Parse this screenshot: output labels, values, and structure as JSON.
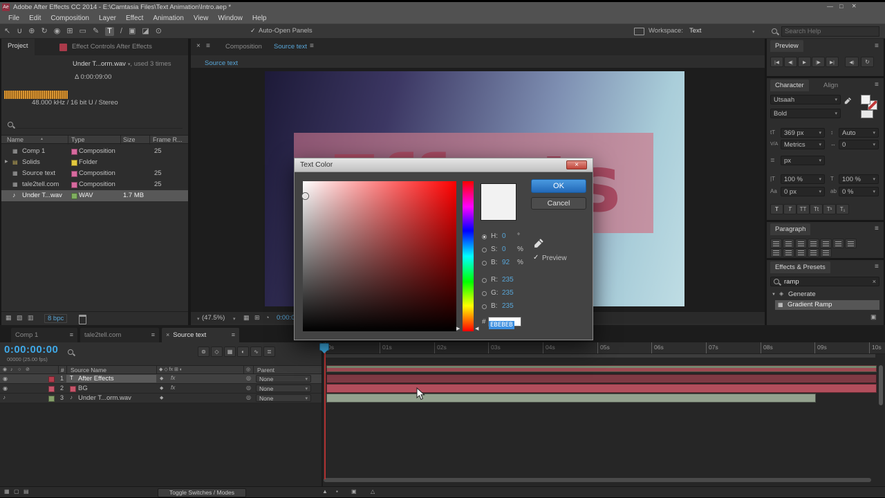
{
  "colors": {
    "accent_blue": "#58a6d8",
    "time_blue": "#3fa9e8",
    "bar_red_dark": "#7e3a44",
    "bar_red": "#b24e5c",
    "bar_green": "#93a18e",
    "box_pink_left": "#8d5673",
    "box_pink_right": "#c493a3",
    "headline_red": "#a84b63",
    "label_pink": "#d76a9e",
    "label_yellow": "#e3c93f",
    "label_green": "#7fae5f",
    "hex_selection": "#3d8fe0",
    "ok_blue": "#2a7fd0"
  },
  "icons": {
    "logo": "Ae",
    "minimize": "—",
    "maximize": "□",
    "close": "×",
    "burger": "≡",
    "dd": "▾",
    "check": "✓",
    "eye": "◉",
    "note": "♪",
    "diamond": "◆",
    "fx": "fx",
    "pick": "◎",
    "expand": "▶",
    "sort": "▲",
    "cat": "▼",
    "grid": "▦"
  },
  "titlebar": {
    "title": "Adobe After Effects CC 2014 - E:\\Camtasia Files\\Text Animation\\Intro.aep *"
  },
  "menus": [
    "File",
    "Edit",
    "Composition",
    "Layer",
    "Effect",
    "Animation",
    "View",
    "Window",
    "Help"
  ],
  "toolbar": {
    "tools": [
      "↖",
      "∪",
      "⊕",
      "↻",
      "◉",
      "⊞",
      "▭",
      "✎",
      "T",
      "/",
      "▣",
      "◪",
      "⊙"
    ],
    "auto_open": "Auto-Open Panels",
    "workspace_label": "Workspace:",
    "workspace_value": "Text",
    "search_placeholder": "Search Help"
  },
  "project": {
    "tab_project": "Project",
    "tab_effect_controls": "Effect Controls After Effects",
    "item_name": "Under T...orm.wav",
    "item_usage": ", used 3 times",
    "item_delta": "Δ 0:00:09:00",
    "item_audio": "48.000 kHz / 16 bit U / Stereo",
    "columns": [
      "Name",
      "Type",
      "Size",
      "Frame R..."
    ],
    "rows": [
      {
        "name": "Comp 1",
        "type": "Composition",
        "size": "",
        "frame": "25"
      },
      {
        "name": "Solids",
        "type": "Folder",
        "size": "",
        "frame": ""
      },
      {
        "name": "Source text",
        "type": "Composition",
        "size": "",
        "frame": "25"
      },
      {
        "name": "tale2tell.com",
        "type": "Composition",
        "size": "",
        "frame": "25"
      },
      {
        "name": "Under T...wav",
        "type": "WAV",
        "size": "1.7 MB",
        "frame": ""
      }
    ],
    "bit_depth": "8 bpc",
    "footer_icons": [
      "▦",
      "▧",
      "▥"
    ]
  },
  "comp": {
    "tab_composition": "Composition",
    "tab_source_text": "Source text",
    "breadcrumb": "Source text",
    "headline": "Effects",
    "zoom": "(47.5%)",
    "time": "0:00:00:00"
  },
  "dialog": {
    "title": "Text Color",
    "ok": "OK",
    "cancel": "Cancel",
    "rows": [
      {
        "label": "H:",
        "value": "0",
        "unit": "°"
      },
      {
        "label": "S:",
        "value": "0",
        "unit": "%"
      },
      {
        "label": "B:",
        "value": "92",
        "unit": "%"
      },
      {
        "label": "R:",
        "value": "235",
        "unit": ""
      },
      {
        "label": "G:",
        "value": "235",
        "unit": ""
      },
      {
        "label": "B:",
        "value": "235",
        "unit": ""
      }
    ],
    "hex_label": "#",
    "hex_value": "EBEBEB",
    "preview": "Preview"
  },
  "preview": {
    "title": "Preview",
    "transport": [
      "|◀",
      "◀|",
      "▶",
      "|▶",
      "▶|"
    ],
    "audio": "◀)",
    "loop": "↻"
  },
  "character": {
    "tab_character": "Character",
    "tab_align": "Align",
    "font_family": "Utsaah",
    "font_style": "Bold",
    "font_size": "369 px",
    "leading": "Auto",
    "kerning": "Metrics",
    "tracking": "0",
    "stroke_width": "px",
    "vscale": "100 %",
    "hscale": "100 %",
    "baseline": "0 px",
    "tsume": "0 %",
    "glyphs": {
      "size": "tT",
      "leading": "↕",
      "kerning": "V/A",
      "tracking": "↔",
      "stroke": "≣",
      "vscale": "|T",
      "hscale": "T",
      "baseline": "Aa",
      "tsume": "ab"
    },
    "style_buttons": [
      "T",
      "T",
      "TT",
      "Tt",
      "T¹",
      "T₁"
    ]
  },
  "paragraph": {
    "title": "Paragraph"
  },
  "effects": {
    "title": "Effects & Presets",
    "search": "ramp",
    "category": "Generate",
    "item": "Gradient Ramp"
  },
  "tl_tabs": [
    {
      "label": "Comp 1"
    },
    {
      "label": "tale2tell.com"
    },
    {
      "label": "Source text"
    }
  ],
  "timeline": {
    "time": "0:00:00:00",
    "frame_info": "00000 (25.00 fps)",
    "col_num": "#",
    "col_source": "Source Name",
    "col_parent": "Parent",
    "tools": [
      "⊚",
      "◇",
      "▦",
      "◐",
      "∿",
      "≣"
    ],
    "ruler": [
      "0s",
      "01s",
      "02s",
      "03s",
      "04s",
      "05s",
      "06s",
      "07s",
      "08s",
      "09s",
      "10s"
    ],
    "layers": [
      {
        "num": "1",
        "name": "After Effects",
        "parent": "None"
      },
      {
        "num": "2",
        "name": "BG",
        "parent": "None"
      },
      {
        "num": "3",
        "name": "Under T...orm.wav",
        "parent": "None"
      }
    ],
    "toggle": "Toggle Switches / Modes"
  },
  "bottombar": {
    "left_icons": [
      "▦",
      "▢",
      "▤"
    ],
    "mid_icons": [
      "▲",
      "▪",
      "▣",
      "△"
    ]
  }
}
